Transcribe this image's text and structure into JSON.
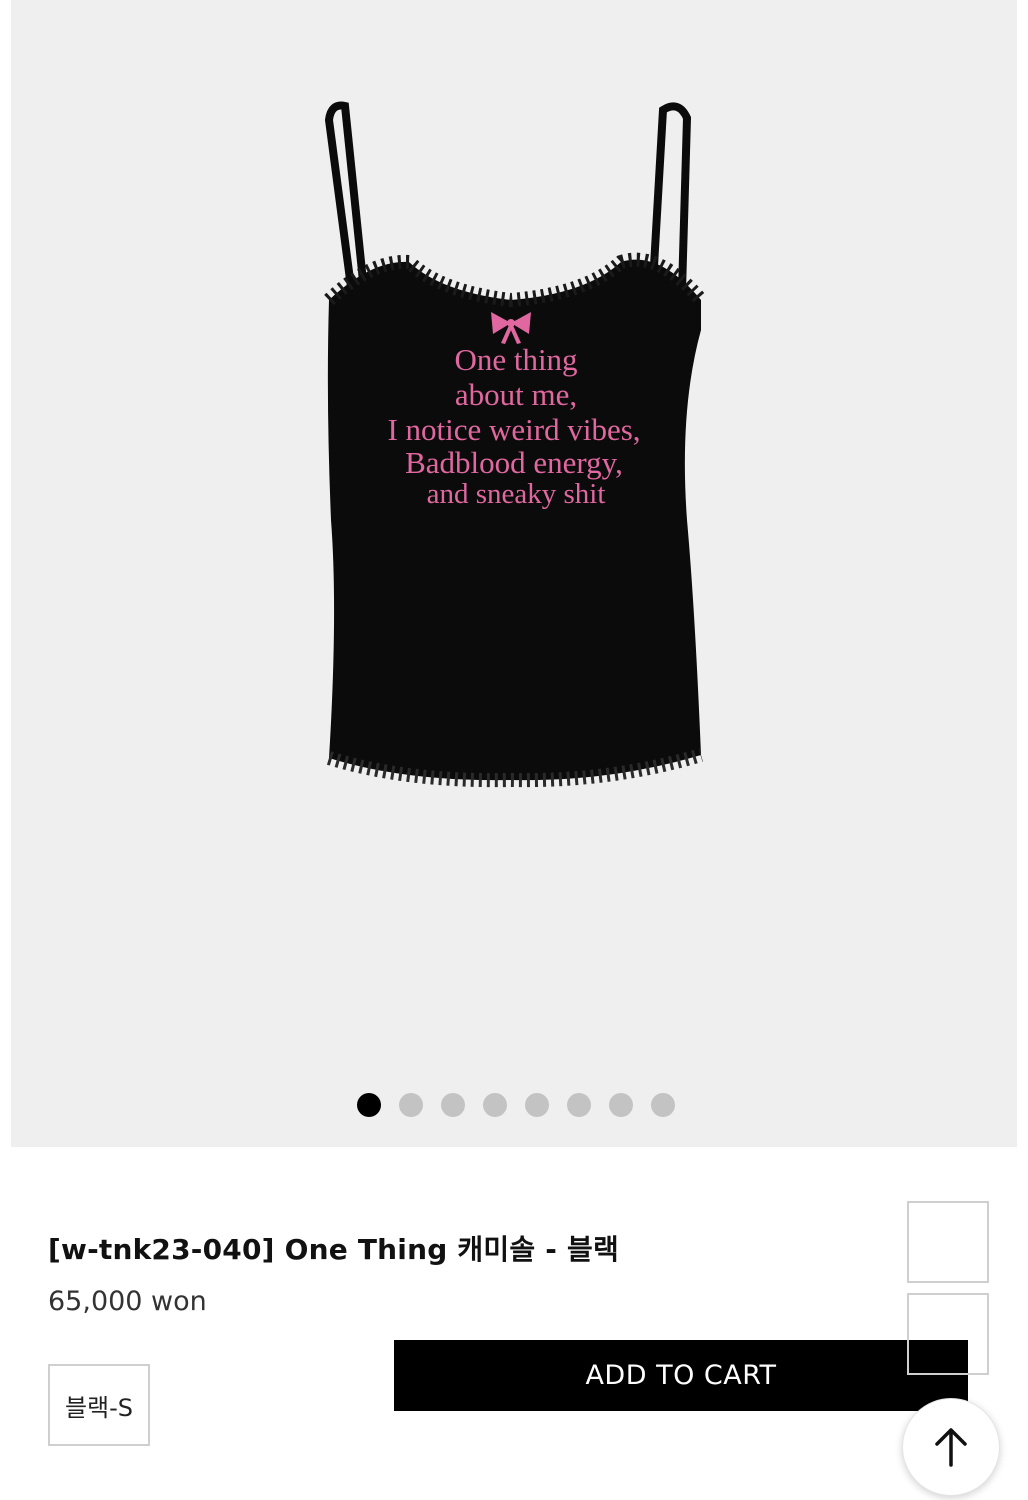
{
  "gallery": {
    "image_count": 8,
    "active_index": 0,
    "print_lines": [
      "One thing",
      "about me,",
      "I notice weird vibes,",
      "Badblood energy,",
      "and sneaky shit"
    ],
    "garment_color": "#0b0b0b",
    "print_color": "#e0679f"
  },
  "product": {
    "title": "[w-tnk23-040] One Thing 캐미솔 - 블랙",
    "price": "65,000 won",
    "selected_option": "블랙-S"
  },
  "actions": {
    "add_to_cart": "ADD TO CART"
  },
  "icons": {
    "scroll_top": "arrow-up-icon"
  }
}
